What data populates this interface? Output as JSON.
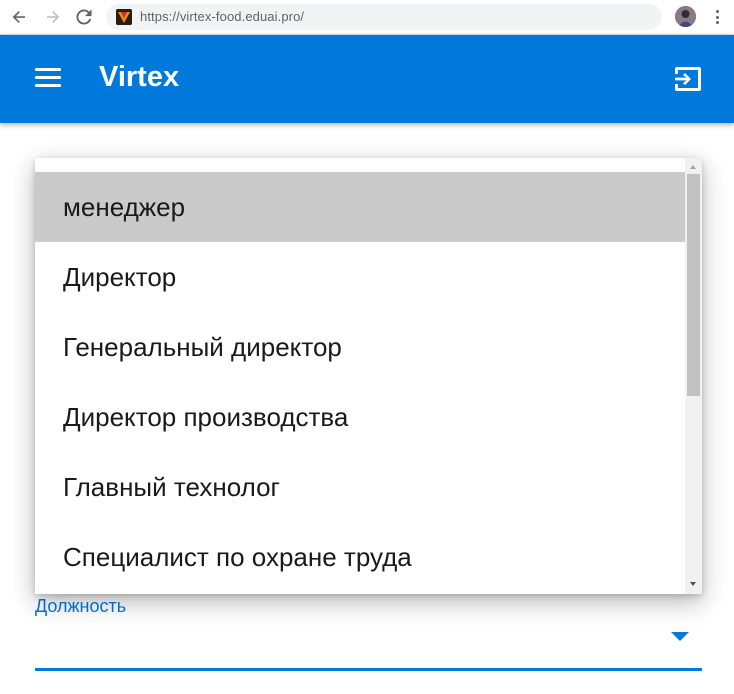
{
  "browser": {
    "url": "https://virtex-food.eduai.pro/",
    "back_icon": "arrow-left",
    "forward_icon": "arrow-right",
    "reload_icon": "reload"
  },
  "appbar": {
    "title": "Virtex",
    "color": "#0179dc",
    "menu_icon": "hamburger-menu",
    "logout_icon": "exit-to-app"
  },
  "form": {
    "position_field": {
      "label": "Должность",
      "value": ""
    }
  },
  "dropdown": {
    "options": [
      {
        "label": "менеджер",
        "selected": true
      },
      {
        "label": "Директор",
        "selected": false
      },
      {
        "label": "Генеральный директор",
        "selected": false
      },
      {
        "label": "Директор производства",
        "selected": false
      },
      {
        "label": "Главный технолог",
        "selected": false
      },
      {
        "label": "Специалист по охране труда",
        "selected": false
      }
    ]
  }
}
